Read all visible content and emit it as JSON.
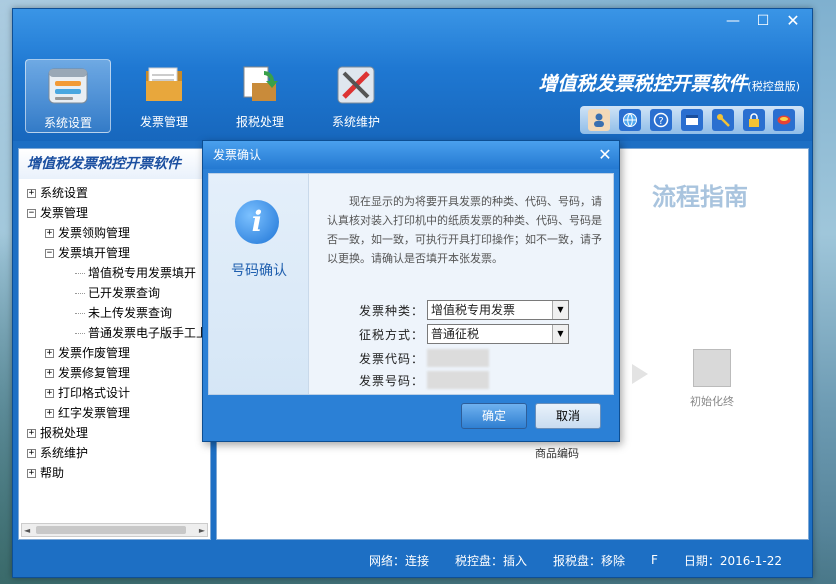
{
  "window": {
    "controls": {
      "minimize": "—",
      "maximize": "☐",
      "close": "✕"
    },
    "brand": "增值税发票税控开票软件",
    "brand_suffix": "(税控盘版)"
  },
  "toolbar": [
    {
      "label": "系统设置",
      "icon": "settings-icon"
    },
    {
      "label": "发票管理",
      "icon": "folder-icon"
    },
    {
      "label": "报税处理",
      "icon": "tax-report-icon"
    },
    {
      "label": "系统维护",
      "icon": "tools-icon"
    }
  ],
  "quick_icons": [
    "user-icon",
    "globe-icon",
    "help-icon",
    "window-icon",
    "key-icon",
    "lock-icon",
    "exit-icon"
  ],
  "nav": {
    "title": "增值税发票税控开票软件",
    "tree": [
      {
        "label": "系统设置",
        "level": 1,
        "sign": "+"
      },
      {
        "label": "发票管理",
        "level": 1,
        "sign": "−"
      },
      {
        "label": "发票领购管理",
        "level": 2,
        "sign": "+"
      },
      {
        "label": "发票填开管理",
        "level": 2,
        "sign": "−"
      },
      {
        "label": "增值税专用发票填开",
        "level": 3
      },
      {
        "label": "已开发票查询",
        "level": 3
      },
      {
        "label": "未上传发票查询",
        "level": 3
      },
      {
        "label": "普通发票电子版手工上",
        "level": 3
      },
      {
        "label": "发票作废管理",
        "level": 2,
        "sign": "+"
      },
      {
        "label": "发票修复管理",
        "level": 2,
        "sign": "+"
      },
      {
        "label": "打印格式设计",
        "level": 2,
        "sign": "+"
      },
      {
        "label": "红字发票管理",
        "level": 2,
        "sign": "+"
      },
      {
        "label": "报税处理",
        "level": 1,
        "sign": "+"
      },
      {
        "label": "系统维护",
        "level": 1,
        "sign": "+"
      },
      {
        "label": "帮助",
        "level": 1,
        "sign": "+"
      }
    ]
  },
  "content": {
    "guide_title": "流程指南",
    "init_end_label": "初始化终",
    "partial_text": "商品编码"
  },
  "status": {
    "network": "网络：连接",
    "tax_disk": "税控盘：插入",
    "report_disk": "报税盘：移除",
    "extra": "F",
    "date": "日期：2016-1-22"
  },
  "dialog": {
    "title": "发票确认",
    "close": "✕",
    "icon_letter": "i",
    "side_label": "号码确认",
    "message": "现在显示的为将要开具发票的种类、代码、号码，请认真核对装入打印机中的纸质发票的种类、代码、号码是否一致，如一致，可执行开具打印操作；如不一致，请予以更换。请确认是否填开本张发票。",
    "fields": {
      "type_label": "发票种类：",
      "type_value": "增值税专用发票",
      "method_label": "征税方式：",
      "method_value": "普通征税",
      "code_label": "发票代码：",
      "number_label": "发票号码："
    },
    "ok_label": "确定",
    "cancel_label": "取消"
  }
}
